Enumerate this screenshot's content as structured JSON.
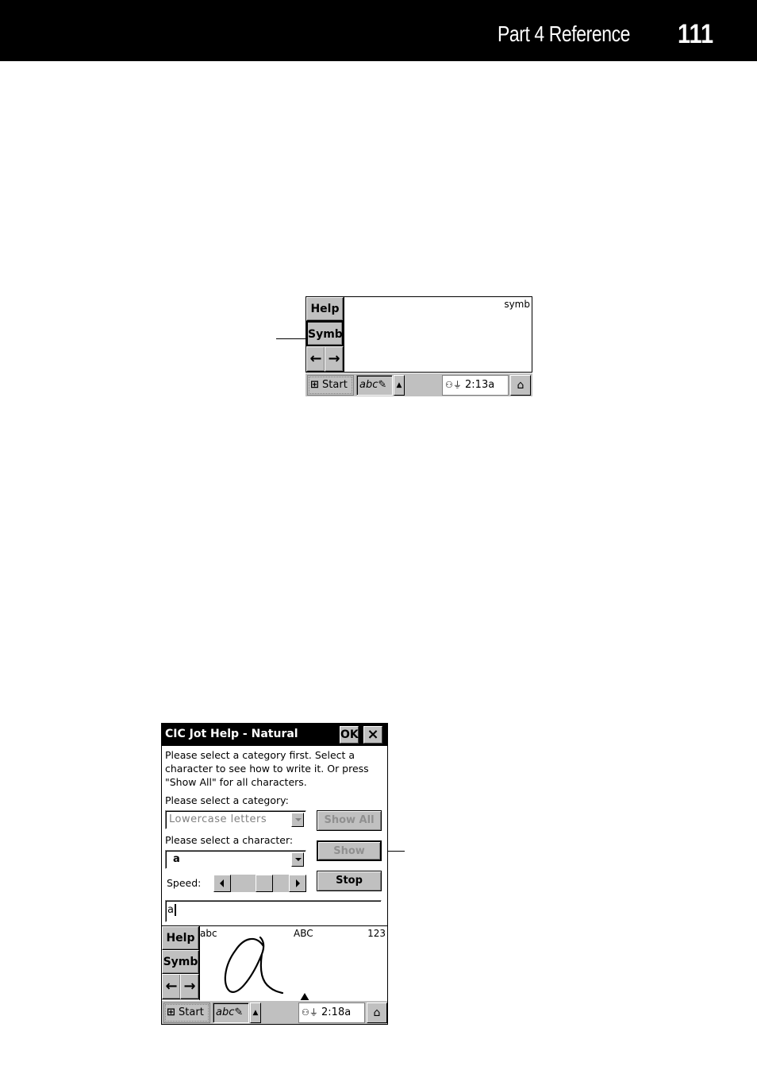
{
  "header": {
    "section": "Part 4  Reference",
    "page_number": "111"
  },
  "figure1": {
    "side_buttons": {
      "help": "Help",
      "symb": "Symb",
      "left_arrow": "←",
      "right_arrow": "→"
    },
    "pad_label": "symb",
    "taskbar": {
      "start": "Start",
      "time": "2:13a"
    }
  },
  "figure2": {
    "title": "CIC Jot Help - Natural",
    "ok_label": "OK",
    "close_label": "×",
    "instructions": [
      "Please select a category first. Select a",
      "character to see how to write it. Or press",
      "\"Show All\" for all characters."
    ],
    "category_label": "Please select a category:",
    "category_value": "Lowercase letters",
    "show_all_label": "Show All",
    "character_label": "Please select a character:",
    "character_value": "a",
    "show_label": "Show",
    "speed_label": "Speed:",
    "speed_position": 0.6,
    "stop_label": "Stop",
    "input_value": "a",
    "side_buttons": {
      "help": "Help",
      "symb": "Symb",
      "left_arrow": "←",
      "right_arrow": "→"
    },
    "pad_labels": {
      "left": "abc",
      "center": "ABC",
      "right": "123"
    },
    "taskbar": {
      "start": "Start",
      "time": "2:18a"
    }
  }
}
